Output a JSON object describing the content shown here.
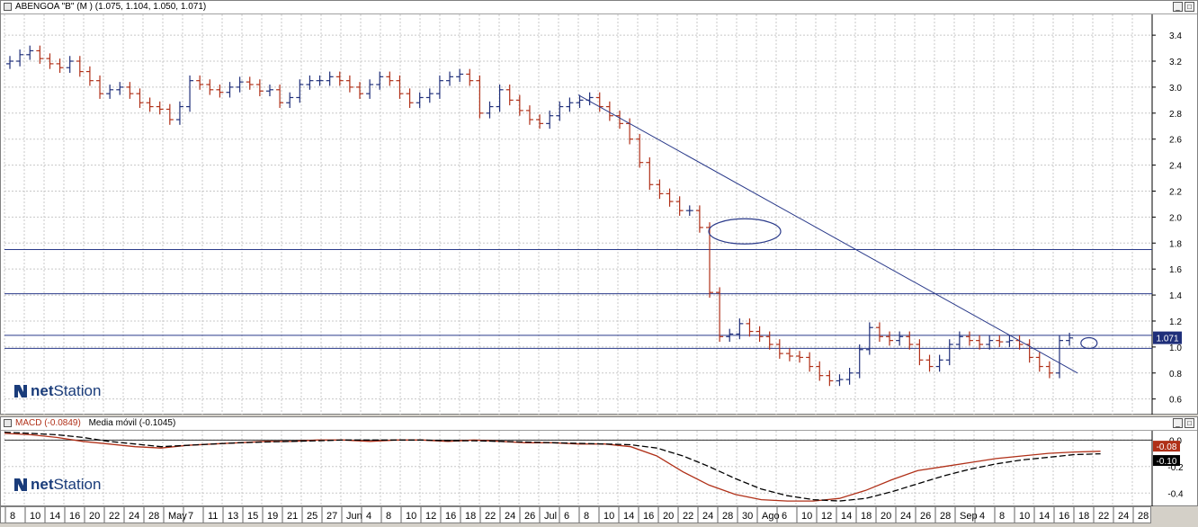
{
  "price_panel": {
    "title": "ABENGOA \"B\" (M ) (1.075, 1.104, 1.050, 1.071)",
    "last_price_badge": "1.071",
    "logo_prefix": "net",
    "logo_suffix": "Station"
  },
  "macd_panel": {
    "title_macd": "MACD (-0.0849)",
    "title_ma": "Media móvil (-0.1045)",
    "badge_macd": "-0.08",
    "badge_ma": "-0.10",
    "logo_prefix": "net",
    "logo_suffix": "Station"
  },
  "colors": {
    "up_bar": "#1f2f7a",
    "down_bar": "#b03018",
    "grid": "#c8c8c8",
    "line": "#2a3a8a",
    "macd": "#b03018",
    "ma": "#000000"
  },
  "icons": {
    "maximize": "maximize-icon",
    "restore": "restore-icon",
    "logo": "netstation-logo-icon"
  },
  "chart_data": [
    {
      "type": "ohlc",
      "series_name": "ABENGOA \"B\"",
      "y_ticks": [
        "3.4",
        "3.2",
        "3.0",
        "2.8",
        "2.6",
        "2.4",
        "2.2",
        "2.0",
        "1.8",
        "1.6",
        "1.4",
        "1.2",
        "1.0",
        "0.8",
        "0.6"
      ],
      "ylim": [
        0.48,
        3.56
      ],
      "x_labels": [
        "8",
        "10",
        "14",
        "16",
        "20",
        "22",
        "24",
        "28",
        "May",
        "7",
        "11",
        "13",
        "15",
        "19",
        "21",
        "25",
        "27",
        "Jun",
        "4",
        "8",
        "10",
        "12",
        "16",
        "18",
        "22",
        "24",
        "26",
        "Jul",
        "6",
        "8",
        "10",
        "14",
        "16",
        "20",
        "22",
        "24",
        "28",
        "30",
        "Ago",
        "6",
        "10",
        "12",
        "14",
        "18",
        "20",
        "24",
        "26",
        "28",
        "Sep",
        "4",
        "8",
        "10",
        "14",
        "16",
        "18",
        "22",
        "24",
        "28"
      ],
      "horizontal_levels": [
        1.75,
        1.41,
        1.09,
        0.99
      ],
      "trendline": {
        "from": [
          0.5,
          2.94
        ],
        "to": [
          0.935,
          0.8
        ]
      },
      "ellipse_annotation_1": {
        "x_frac": 0.645,
        "y": 1.89
      },
      "ellipse_annotation_2": {
        "x_frac": 0.945,
        "y": 1.03
      },
      "closes": [
        3.2,
        3.25,
        3.28,
        3.22,
        3.18,
        3.15,
        3.2,
        3.12,
        3.05,
        2.95,
        2.98,
        3.0,
        2.95,
        2.88,
        2.85,
        2.83,
        2.75,
        2.85,
        3.05,
        3.02,
        2.98,
        2.96,
        3.0,
        3.04,
        3.02,
        2.97,
        2.98,
        2.88,
        2.92,
        3.02,
        3.05,
        3.05,
        3.08,
        3.05,
        3.0,
        2.95,
        3.02,
        3.08,
        3.05,
        2.95,
        2.88,
        2.92,
        2.95,
        3.05,
        3.08,
        3.1,
        3.05,
        2.8,
        2.85,
        2.98,
        2.9,
        2.82,
        2.75,
        2.72,
        2.78,
        2.85,
        2.88,
        2.9,
        2.92,
        2.85,
        2.78,
        2.72,
        2.6,
        2.42,
        2.25,
        2.18,
        2.12,
        2.05,
        2.05,
        1.92,
        1.42,
        1.08,
        1.1,
        1.18,
        1.12,
        1.08,
        1.02,
        0.95,
        0.93,
        0.92,
        0.85,
        0.78,
        0.74,
        0.75,
        0.8,
        0.98,
        1.15,
        1.08,
        1.05,
        1.08,
        1.02,
        0.9,
        0.85,
        0.9,
        1.02,
        1.08,
        1.05,
        1.02,
        1.05,
        1.04,
        1.05,
        1.02,
        0.92,
        0.85,
        0.8,
        1.05,
        1.07
      ]
    },
    {
      "type": "line",
      "title": "MACD",
      "y_ticks": [
        "0.0",
        "-0.2",
        "-0.4"
      ],
      "ylim": [
        -0.5,
        0.07
      ],
      "series": [
        {
          "name": "MACD",
          "values": [
            0.05,
            0.04,
            0.02,
            -0.01,
            -0.03,
            -0.05,
            -0.06,
            -0.04,
            -0.03,
            -0.02,
            -0.01,
            -0.01,
            0.0,
            0.0,
            -0.01,
            0.0,
            0.0,
            -0.01,
            0.0,
            -0.01,
            -0.02,
            -0.02,
            -0.03,
            -0.03,
            -0.05,
            -0.12,
            -0.24,
            -0.34,
            -0.41,
            -0.45,
            -0.46,
            -0.46,
            -0.44,
            -0.38,
            -0.3,
            -0.23,
            -0.2,
            -0.17,
            -0.14,
            -0.12,
            -0.1,
            -0.09,
            -0.085
          ]
        },
        {
          "name": "Media móvil",
          "values": [
            0.06,
            0.05,
            0.04,
            0.02,
            -0.01,
            -0.03,
            -0.05,
            -0.04,
            -0.03,
            -0.02,
            -0.015,
            -0.01,
            -0.005,
            0.0,
            0.0,
            0.0,
            0.0,
            -0.005,
            -0.005,
            -0.01,
            -0.015,
            -0.02,
            -0.025,
            -0.03,
            -0.035,
            -0.06,
            -0.12,
            -0.2,
            -0.29,
            -0.37,
            -0.42,
            -0.45,
            -0.46,
            -0.44,
            -0.39,
            -0.33,
            -0.27,
            -0.22,
            -0.18,
            -0.15,
            -0.13,
            -0.11,
            -0.104
          ]
        }
      ]
    }
  ]
}
